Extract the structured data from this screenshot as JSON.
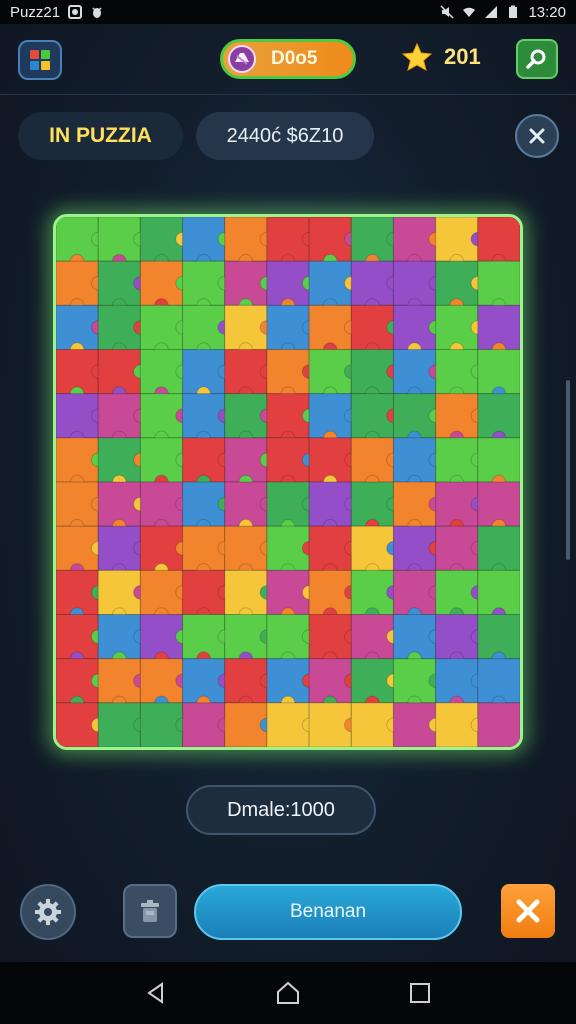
{
  "status_bar": {
    "app_name": "Puzz21",
    "time": "13:20",
    "icons": [
      "notification-icon",
      "bug-icon",
      "mute-icon",
      "wifi-icon",
      "signal-icon",
      "battery-icon"
    ]
  },
  "header": {
    "menu_icon": "blocks-menu-icon",
    "coins": "D0o5",
    "star_count": "201",
    "search_icon": "search-icon"
  },
  "info": {
    "title": "IN PUZZIA",
    "code": "2440ć $6Z10"
  },
  "board": {
    "columns": 11,
    "rows": 12,
    "border_color": "#9cf58a",
    "piece_palette": [
      "#e03030",
      "#f07a1c",
      "#f5c22a",
      "#4cc93a",
      "#2fa84a",
      "#2e86d0",
      "#8b3fc4",
      "#c43a8c"
    ]
  },
  "footer": {
    "moves_label": "Dmale:1000",
    "main_button_label": "Benanan",
    "settings_icon": "gear-icon",
    "trash_icon": "trash-icon",
    "close_icon": "close-icon"
  },
  "nav": {
    "back_icon": "back-icon",
    "home_icon": "home-icon",
    "recents_icon": "recents-icon"
  },
  "colors": {
    "accent_orange": "#f08a1c",
    "accent_green": "#4fc93f",
    "accent_blue": "#1a7fb8",
    "star_yellow": "#ffd23a"
  }
}
